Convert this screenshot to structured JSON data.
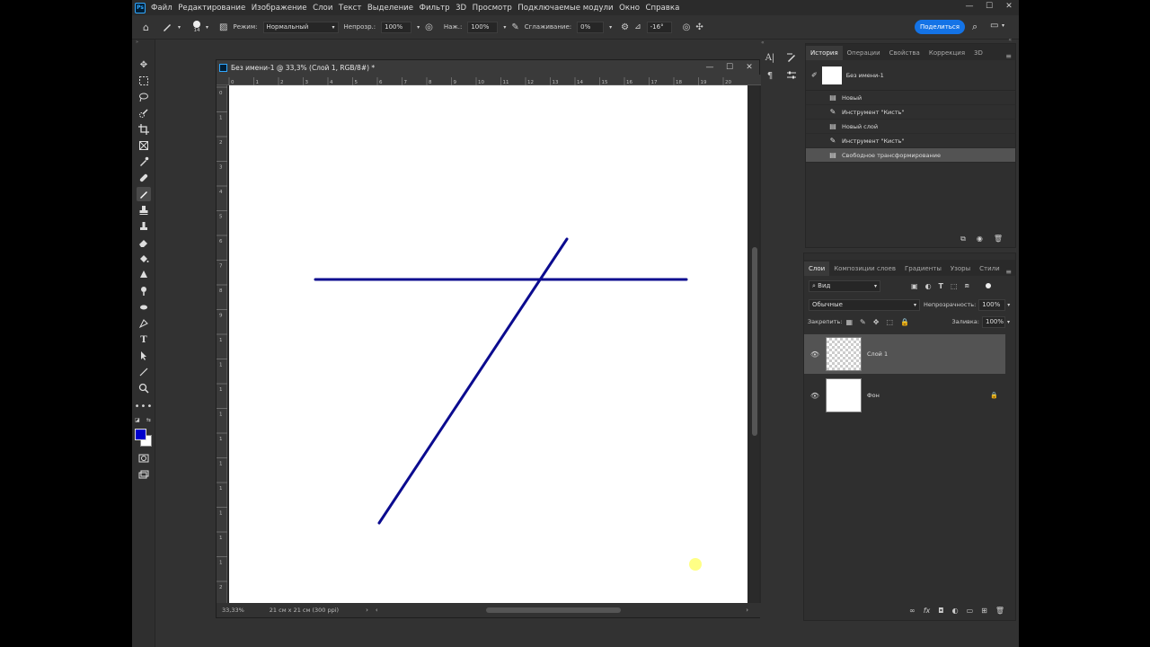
{
  "menu": {
    "logo": "Ps",
    "items": [
      "Файл",
      "Редактирование",
      "Изображение",
      "Слои",
      "Текст",
      "Выделение",
      "Фильтр",
      "3D",
      "Просмотр",
      "Подключаемые модули",
      "Окно",
      "Справка"
    ],
    "window_controls": [
      "—",
      "☐",
      "✕"
    ]
  },
  "options": {
    "brush_size": "14",
    "mode_label": "Режим:",
    "mode_value": "Нормальный",
    "opacity_label": "Непрозр.:",
    "opacity_value": "100%",
    "flow_label": "Наж.:",
    "flow_value": "100%",
    "smoothing_label": "Сглаживание:",
    "smoothing_value": "0%",
    "angle_value": "-16°",
    "share_label": "Поделиться"
  },
  "document": {
    "title": "Без имени-1 @ 33,3% (Слой 1, RGB/8#) *",
    "zoom": "33,33%",
    "doc_info": "21 см x 21 см (300 ppi)",
    "ruler_top": [
      "0",
      "1",
      "2",
      "3",
      "4",
      "5",
      "6",
      "7",
      "8",
      "9",
      "10",
      "11",
      "12",
      "13",
      "14",
      "15",
      "16",
      "17",
      "18",
      "19",
      "20"
    ],
    "ruler_left": [
      "0",
      "1",
      "2",
      "3",
      "4",
      "5",
      "6",
      "7",
      "8",
      "9",
      "1",
      "1",
      "1",
      "1",
      "1",
      "1",
      "1",
      "1",
      "1",
      "1",
      "2"
    ]
  },
  "colors": {
    "foreground": "#0000cc",
    "background": "#ffffff",
    "stroke": "#0b0b8f",
    "highlight": "#ffff66",
    "accent": "#1473e6"
  },
  "history": {
    "tabs": [
      "История",
      "Операции",
      "Свойства",
      "Коррекция",
      "3D"
    ],
    "snapshot": "Без имени-1",
    "items": [
      "Новый",
      "Инструмент \"Кисть\"",
      "Новый слой",
      "Инструмент \"Кисть\"",
      "Свободное трансформирование"
    ]
  },
  "layers": {
    "tabs": [
      "Слои",
      "Композиции слоев",
      "Градиенты",
      "Узоры",
      "Стили"
    ],
    "filter_label": "Вид",
    "blend_mode": "Обычные",
    "opacity_label": "Непрозрачность:",
    "opacity_value": "100%",
    "lock_label": "Закрепить:",
    "fill_label": "Заливка:",
    "fill_value": "100%",
    "items": [
      {
        "name": "Слой 1"
      },
      {
        "name": "Фон"
      }
    ]
  }
}
